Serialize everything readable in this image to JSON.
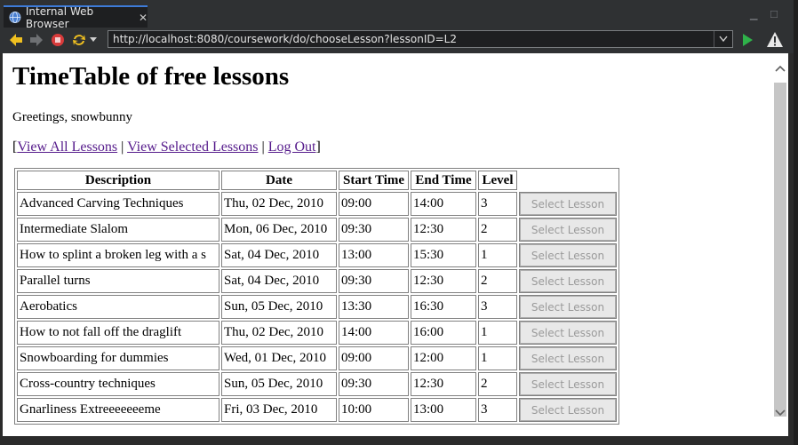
{
  "window": {
    "tab_title": "Internal Web Browser",
    "url": "http://localhost:8080/coursework/do/chooseLesson?lessonID=L2"
  },
  "page": {
    "title": "TimeTable of free lessons",
    "greeting": "Greetings, snowbunny",
    "nav": {
      "open_bracket": "[",
      "view_all": "View All Lessons",
      "sep1": " | ",
      "view_selected": "View Selected Lessons",
      "sep2": " | ",
      "logout": "Log Out",
      "close_bracket": "]"
    },
    "table": {
      "headers": [
        "Description",
        "Date",
        "Start Time",
        "End Time",
        "Level"
      ],
      "button_label": "Select Lesson",
      "rows": [
        [
          "Advanced Carving Techniques",
          "Thu, 02 Dec, 2010",
          "09:00",
          "14:00",
          "3"
        ],
        [
          "Intermediate Slalom",
          "Mon, 06 Dec, 2010",
          "09:30",
          "12:30",
          "2"
        ],
        [
          "How to splint a broken leg with a s",
          "Sat, 04 Dec, 2010",
          "13:00",
          "15:30",
          "1"
        ],
        [
          "Parallel turns",
          "Sat, 04 Dec, 2010",
          "09:30",
          "12:30",
          "2"
        ],
        [
          "Aerobatics",
          "Sun, 05 Dec, 2010",
          "13:30",
          "16:30",
          "3"
        ],
        [
          "How to not fall off the draglift",
          "Thu, 02 Dec, 2010",
          "14:00",
          "16:00",
          "1"
        ],
        [
          "Snowboarding for dummies",
          "Wed, 01 Dec, 2010",
          "09:00",
          "12:00",
          "1"
        ],
        [
          "Cross-country techniques",
          "Sun, 05 Dec, 2010",
          "09:30",
          "12:30",
          "2"
        ],
        [
          "Gnarliness Extreeeeeeeme",
          "Fri, 03 Dec, 2010",
          "10:00",
          "13:00",
          "3"
        ]
      ]
    }
  },
  "colors": {
    "chrome_bg": "#2f3133",
    "link_visited": "#551a8b",
    "tab_accent": "#3d7bd8",
    "go_green": "#2fb24a",
    "stop_red": "#d83b3b",
    "nav_yellow": "#f0c020"
  },
  "icons": [
    "globe-icon",
    "close-icon",
    "back-icon",
    "forward-icon",
    "stop-icon",
    "refresh-icon",
    "chevron-down-icon",
    "go-icon",
    "warning-icon"
  ]
}
